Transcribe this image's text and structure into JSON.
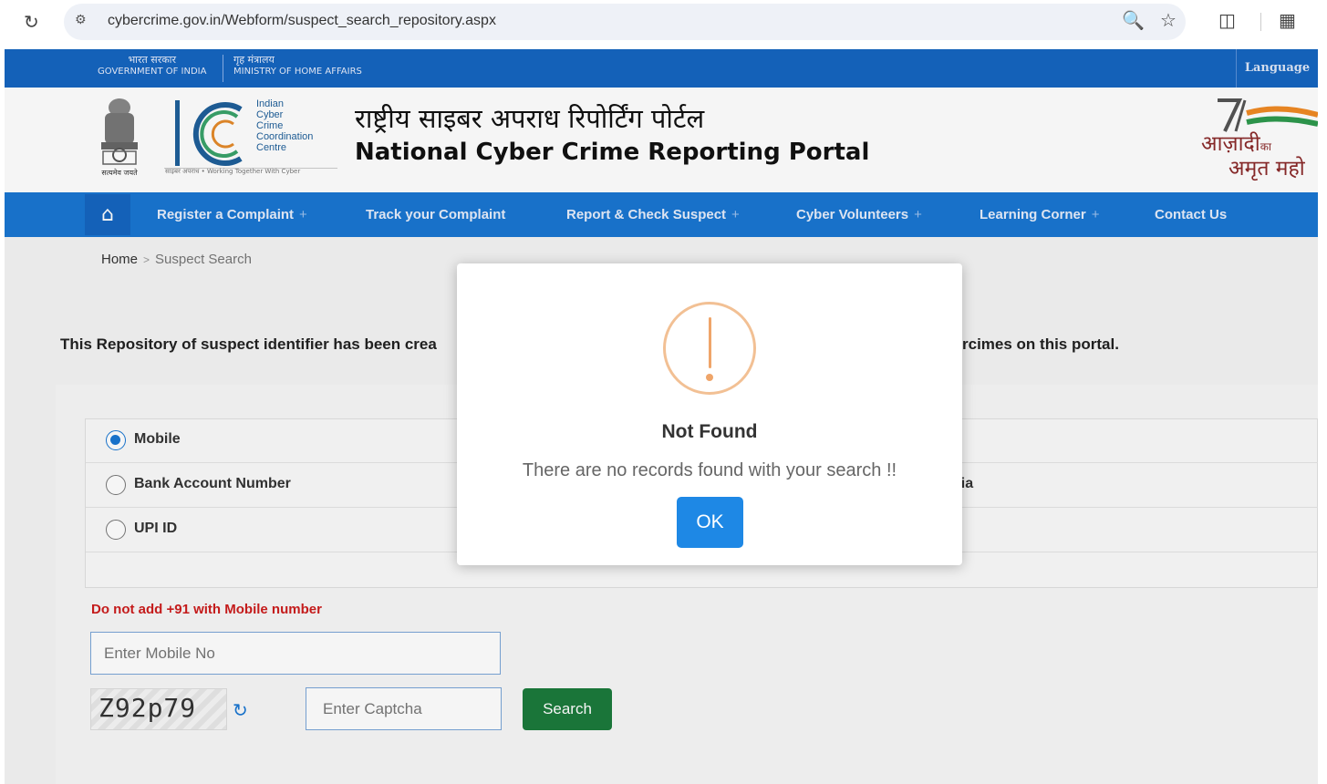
{
  "browser": {
    "url": "cybercrime.gov.in/Webform/suspect_search_repository.aspx",
    "icons": [
      "reload-icon",
      "site-info-icon",
      "zoom-icon",
      "star-icon",
      "extensions-icon",
      "side-panel-icon"
    ]
  },
  "gov_strip": {
    "goi_hi": "भारत सरकार",
    "goi_en": "GOVERNMENT OF INDIA",
    "mha_hi": "गृह मंत्रालय",
    "mha_en": "MINISTRY OF HOME AFFAIRS",
    "language": "Language"
  },
  "header": {
    "emblem_caption": "सत्यमेव जयते",
    "i4c_lines": [
      "Indian",
      "Cyber",
      "Crime",
      "Coordination",
      "Centre"
    ],
    "i4c_tagline": "साइबर अपराध • Working Together With Cyber",
    "title_hi": "राष्ट्रीय साइबर अपराध रिपोर्टिंग पोर्टल",
    "title_en": "National Cyber Crime Reporting Portal",
    "azadi_line1": "आज़ादी",
    "azadi_ka": "का",
    "azadi_line2": "अमृत महो"
  },
  "nav": {
    "home_icon": "home-icon",
    "items": [
      {
        "label": "Register a Complaint",
        "has_sub": "+"
      },
      {
        "label": "Track your Complaint",
        "has_sub": ""
      },
      {
        "label": "Report & Check Suspect",
        "has_sub": "+"
      },
      {
        "label": "Cyber Volunteers",
        "has_sub": "+"
      },
      {
        "label": "Learning Corner",
        "has_sub": "+"
      },
      {
        "label": "Contact Us",
        "has_sub": ""
      }
    ]
  },
  "breadcrumb": {
    "home": "Home",
    "separator": ">",
    "current": "Suspect Search"
  },
  "intro": {
    "left": "This Repository of suspect identifier has been crea",
    "right": "rcimes on this portal."
  },
  "form": {
    "options": [
      {
        "label": "Mobile",
        "selected": true
      },
      {
        "label": "Bank Account Number",
        "selected": false
      },
      {
        "label": "UPI ID",
        "selected": false
      }
    ],
    "right_fragment": "dia",
    "warning": "Do not add +91 with Mobile number",
    "mobile_placeholder": "Enter Mobile No",
    "captcha_text": "Z92p79",
    "captcha_placeholder": "Enter Captcha",
    "search_label": "Search"
  },
  "modal": {
    "title": "Not Found",
    "message": "There are no records found with your search !!",
    "ok_label": "OK"
  },
  "colors": {
    "primary_blue": "#1976d2",
    "search_green": "#1c7a3c",
    "warning_red": "#cc1d1d",
    "alert_orange": "#efa56a",
    "ok_blue": "#1e88e5"
  }
}
